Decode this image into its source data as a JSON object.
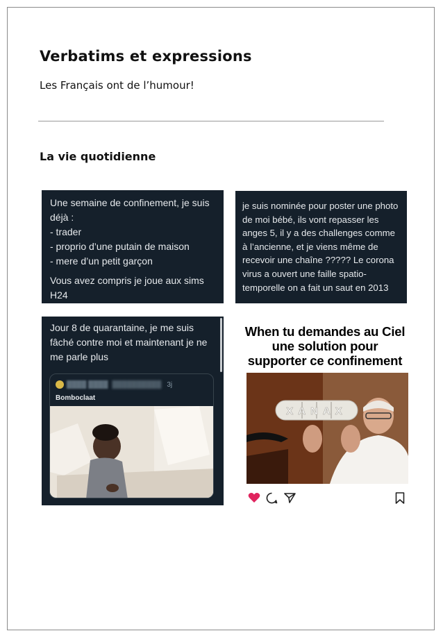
{
  "header": {
    "title": "Verbatims et expressions",
    "subtitle": "Les Français ont de l’humour!"
  },
  "section": {
    "title": "La vie quotidienne"
  },
  "cards": {
    "card1": {
      "lines": [
        "Une semaine de confinement, je suis",
        "déjà :",
        "- trader",
        "- proprio d’une putain de maison",
        "- mere d’un petit garçon"
      ],
      "lines2": [
        "Vous avez compris je joue aux sims",
        "H24"
      ]
    },
    "card2": {
      "text": "je suis nominée pour poster une photo de moi bébé, ils vont repasser les anges 5, il y a des challenges comme à l’ancienne, et je viens même de recevoir une chaîne ????? Le corona virus a ouvert une faille spatio-temporelle on a fait un saut en 2013"
    },
    "card3": {
      "text": "Jour 8 de quarantaine, je me suis fâché contre moi et maintenant je ne me parle plus",
      "quote": {
        "time": "3j",
        "text": "Bomboclaat"
      }
    },
    "card4": {
      "caption": "When tu demandes au Ciel une solution pour supporter ce confinement",
      "pill_text": "XANAX"
    }
  },
  "colors": {
    "tweet_bg": "#15202b",
    "heart": "#e0245e"
  },
  "icons": [
    "heart-icon",
    "comment-icon",
    "share-icon",
    "bookmark-icon"
  ]
}
